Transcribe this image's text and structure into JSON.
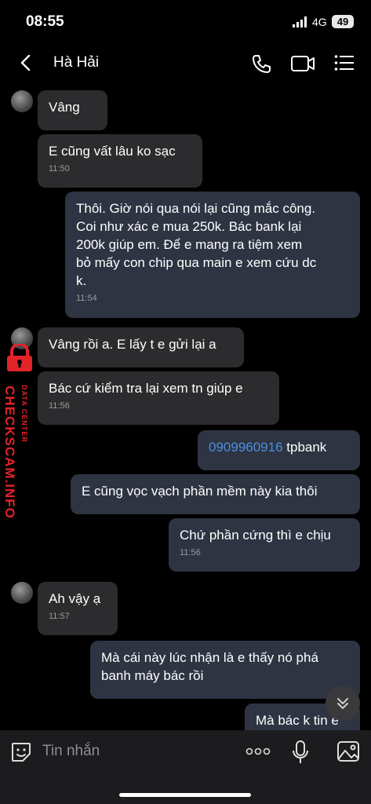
{
  "status_bar": {
    "time": "08:55",
    "network": "4G",
    "battery": "49"
  },
  "header": {
    "contact_name": "Hà Hải"
  },
  "messages": [
    {
      "dir": "in",
      "text": "Vâng",
      "time": ""
    },
    {
      "dir": "in",
      "text": "E cũng vất lâu ko sạc",
      "time": "11:50"
    },
    {
      "dir": "out",
      "text": "Thôi. Giờ nói qua nói lại cũng mắc công.\nCoi như xác e mua 250k. Bác bank lại\n200k giúp em.  Để e mang ra tiệm xem\nbỏ mấy con chip qua main e xem cứu dc\nk.",
      "time": "11:54"
    },
    {
      "dir": "in",
      "text": "Vâng rồi a. E lấy t e gửi lại a",
      "time": ""
    },
    {
      "dir": "in",
      "text": "Bác cứ kiểm tra lại xem tn giúp e",
      "time": "11:56"
    },
    {
      "dir": "out",
      "link": "0909960916",
      "text": " tpbank",
      "time": ""
    },
    {
      "dir": "out",
      "text": "E cũng vọc vạch phần mềm này kia thôi",
      "time": ""
    },
    {
      "dir": "out",
      "text": "Chứ phần cứng thì e chịu",
      "time": "11:56"
    },
    {
      "dir": "in",
      "text": "Ah vậy ạ",
      "time": "11:57"
    },
    {
      "dir": "out",
      "text": "Mà cái này lúc nhận là e thấy nó phá\nbanh máy bác rồi",
      "time": ""
    },
    {
      "dir": "out",
      "text": "Mà bác k tin e",
      "time": ""
    }
  ],
  "composer": {
    "placeholder": "Tin nhắn"
  },
  "watermark": {
    "main": "CHECKSCAM.INFO",
    "sub": "DATA CENTER"
  },
  "colors": {
    "incoming": "#2c2c2e",
    "outgoing": "#2e3442",
    "link": "#4a8fe0",
    "watermark": "#e0242a"
  }
}
